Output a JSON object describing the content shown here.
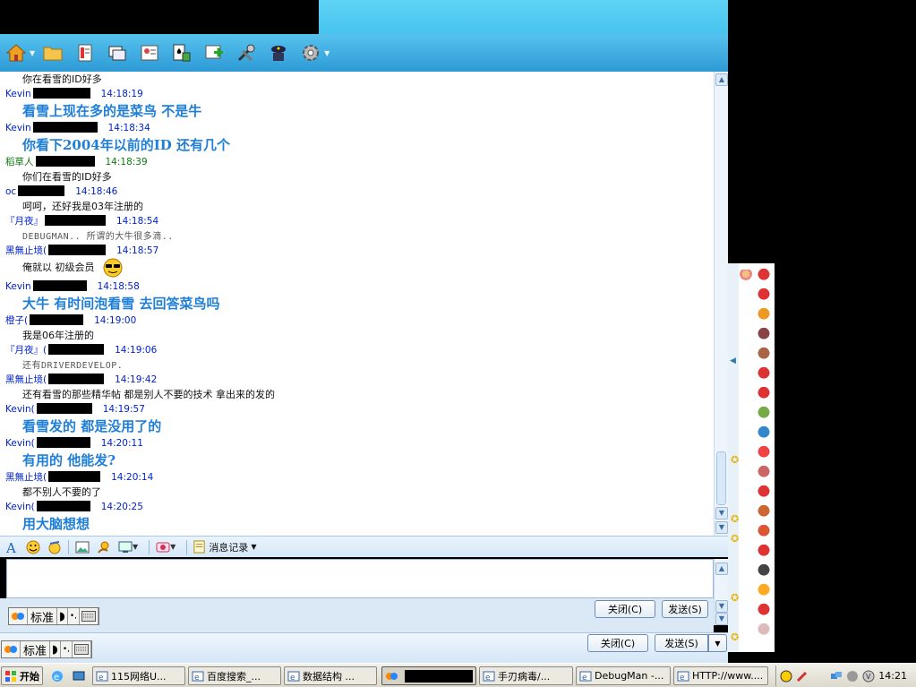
{
  "chat": {
    "entries": [
      {
        "type": "msg",
        "style": "normal",
        "text": "你在看雪的ID好多"
      },
      {
        "type": "hdr",
        "name": "Kevin",
        "time": "14:18:19"
      },
      {
        "type": "msg",
        "style": "big",
        "text": "看雪上现在多的是菜鸟 不是牛"
      },
      {
        "type": "hdr",
        "name": "Kevin",
        "time": "14:18:34"
      },
      {
        "type": "msg",
        "style": "big",
        "text": "你看下2004年以前的ID 还有几个"
      },
      {
        "type": "hdr",
        "name": "稻草人",
        "time": "14:18:39",
        "color": "green"
      },
      {
        "type": "msg",
        "style": "normal",
        "text": "你们在看雪的ID好多"
      },
      {
        "type": "hdr",
        "name": "oc",
        "time": "14:18:46"
      },
      {
        "type": "msg",
        "style": "normal",
        "text": "呵呵，还好我是03年注册的"
      },
      {
        "type": "hdr",
        "name": "『月夜』",
        "time": "14:18:54"
      },
      {
        "type": "msg",
        "style": "grey",
        "text": "DEBUGMAN..  所谓的大牛很多滴.."
      },
      {
        "type": "hdr",
        "name": "黑無止境(",
        "time": "14:18:57"
      },
      {
        "type": "msg",
        "style": "normal",
        "text": "俺就以 初级会员"
      },
      {
        "type": "hdr",
        "name": "Kevin",
        "time": "14:18:58"
      },
      {
        "type": "msg",
        "style": "big",
        "text": "大牛 有时间泡看雪 去回答菜鸟吗"
      },
      {
        "type": "hdr",
        "name": "橙子(",
        "time": "14:19:00"
      },
      {
        "type": "msg",
        "style": "normal",
        "text": "我是06年注册的"
      },
      {
        "type": "hdr",
        "name": "『月夜』(",
        "time": "14:19:06"
      },
      {
        "type": "msg",
        "style": "grey",
        "text": "还有DRIVERDEVELOP."
      },
      {
        "type": "hdr",
        "name": "黑無止境(",
        "time": "14:19:42"
      },
      {
        "type": "msg",
        "style": "normal",
        "text": "还有看雪的那些精华帖 都是别人不要的技术 拿出来的发的"
      },
      {
        "type": "hdr",
        "name": "Kevin(",
        "time": "14:19:57"
      },
      {
        "type": "msg",
        "style": "big",
        "text": "看雪发的 都是没用了的"
      },
      {
        "type": "hdr",
        "name": "Kevin(",
        "time": "14:20:11"
      },
      {
        "type": "msg",
        "style": "big",
        "text": "有用的 他能发?"
      },
      {
        "type": "hdr",
        "name": "黑無止境(",
        "time": "14:20:14"
      },
      {
        "type": "msg",
        "style": "normal",
        "text": "都不别人不要的了"
      },
      {
        "type": "hdr",
        "name": "Kevin(",
        "time": "14:20:25"
      },
      {
        "type": "msg",
        "style": "big",
        "text": "用大脑想想"
      }
    ]
  },
  "format_bar": {
    "message_log_label": "消息记录"
  },
  "ime": {
    "mode_label": "标准"
  },
  "inner_buttons": {
    "close": "关闭(C)",
    "send": "发送(S)"
  },
  "outer_buttons": {
    "close": "关闭(C)",
    "send": "发送(S)"
  },
  "taskbar": {
    "start_label": "开始",
    "tasks": [
      {
        "label": "115网络U..."
      },
      {
        "label": "百度搜索_..."
      },
      {
        "label": "数据结构 ..."
      },
      {
        "label": ""
      },
      {
        "label": "手刃病毒/..."
      },
      {
        "label": "DebugMan -..."
      },
      {
        "label": "HTTP://www...."
      }
    ],
    "clock": "14:21"
  },
  "colors": {
    "toolbar": "#2e9ad6",
    "name_blue": "#0022cc",
    "name_green": "#117711",
    "big_msg": "#1f7fd8"
  }
}
